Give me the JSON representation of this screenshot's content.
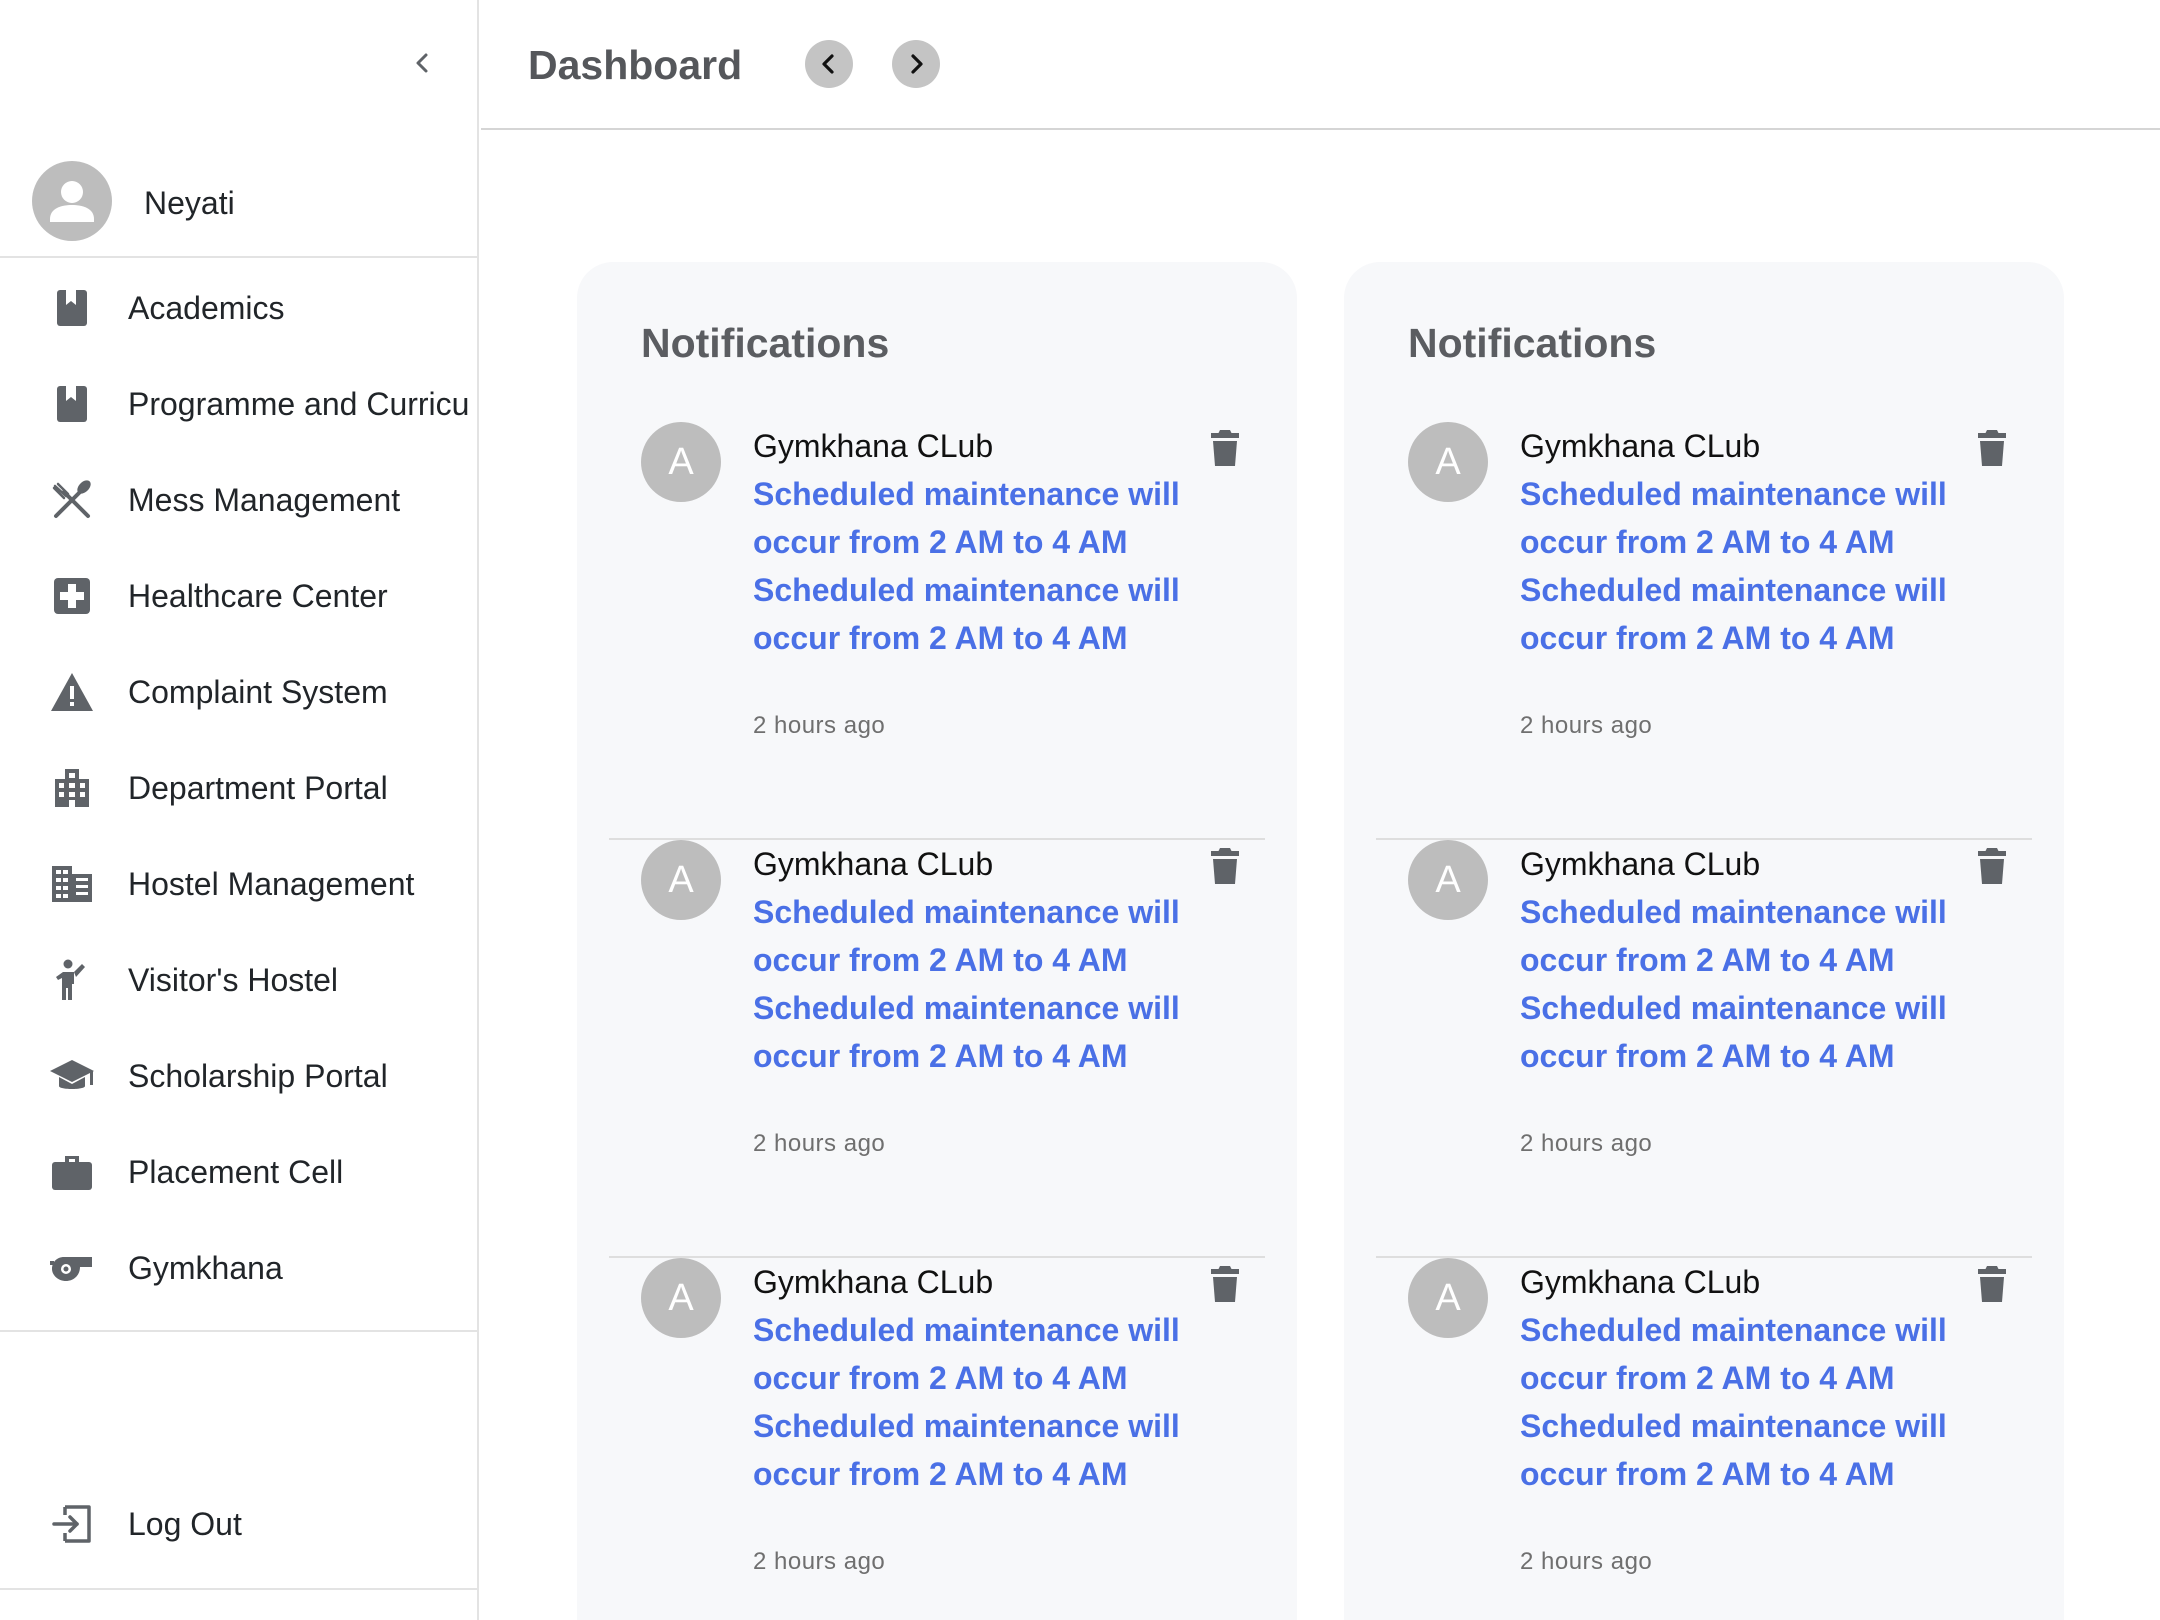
{
  "sidebar": {
    "user_name": "Neyati",
    "items": [
      {
        "label": "Academics",
        "icon": "book-icon"
      },
      {
        "label": "Programme and Curricu",
        "icon": "book-icon"
      },
      {
        "label": "Mess Management",
        "icon": "utensils-icon"
      },
      {
        "label": "Healthcare Center",
        "icon": "medical-cross-icon"
      },
      {
        "label": "Complaint System",
        "icon": "warning-icon"
      },
      {
        "label": "Department Portal",
        "icon": "building-icon"
      },
      {
        "label": "Hostel Management",
        "icon": "buildings-icon"
      },
      {
        "label": "Visitor's Hostel",
        "icon": "person-waving-icon"
      },
      {
        "label": "Scholarship Portal",
        "icon": "graduation-cap-icon"
      },
      {
        "label": "Placement Cell",
        "icon": "briefcase-icon"
      },
      {
        "label": "Gymkhana",
        "icon": "whistle-icon"
      }
    ],
    "logout_label": "Log Out"
  },
  "header": {
    "title": "Dashboard"
  },
  "cards": [
    {
      "title": "Notifications",
      "notifications": [
        {
          "avatar_letter": "A",
          "sender": "Gymkhana CLub",
          "message": "Scheduled maintenance will occur from 2 AM to 4 AM Scheduled maintenance will occur from 2 AM to 4 AM",
          "time": "2 hours ago"
        },
        {
          "avatar_letter": "A",
          "sender": "Gymkhana CLub",
          "message": "Scheduled maintenance will occur from 2 AM to 4 AM Scheduled maintenance will occur from 2 AM to 4 AM",
          "time": "2 hours ago"
        },
        {
          "avatar_letter": "A",
          "sender": "Gymkhana CLub",
          "message": "Scheduled maintenance will occur from 2 AM to 4 AM Scheduled maintenance will occur from 2 AM to 4 AM",
          "time": "2 hours ago"
        }
      ]
    },
    {
      "title": "Notifications",
      "notifications": [
        {
          "avatar_letter": "A",
          "sender": "Gymkhana CLub",
          "message": "Scheduled maintenance will occur from 2 AM to 4 AM Scheduled maintenance will occur from 2 AM to 4 AM",
          "time": "2 hours ago"
        },
        {
          "avatar_letter": "A",
          "sender": "Gymkhana CLub",
          "message": "Scheduled maintenance will occur from 2 AM to 4 AM Scheduled maintenance will occur from 2 AM to 4 AM",
          "time": "2 hours ago"
        },
        {
          "avatar_letter": "A",
          "sender": "Gymkhana CLub",
          "message": "Scheduled maintenance will occur from 2 AM to 4 AM Scheduled maintenance will occur from 2 AM to 4 AM",
          "time": "2 hours ago"
        }
      ]
    }
  ],
  "colors": {
    "link": "#4a70e6",
    "icon": "#5f6368",
    "avatar": "#bdbdbd",
    "card_bg": "#f7f8fa"
  }
}
